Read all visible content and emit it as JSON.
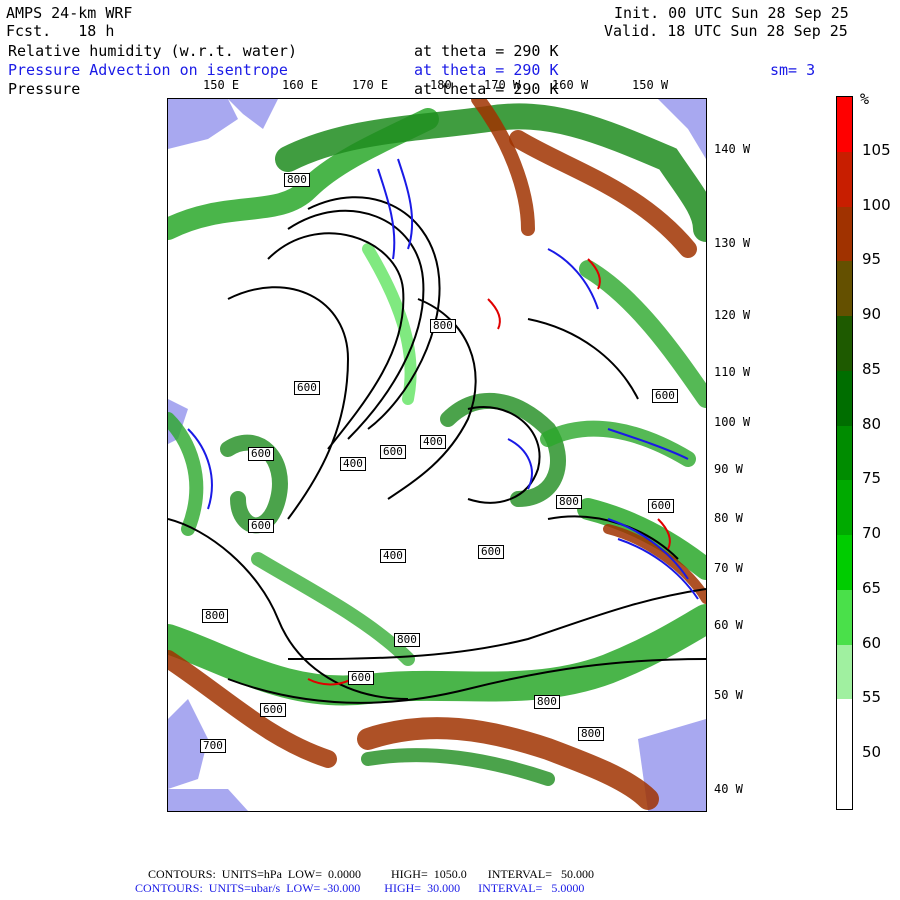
{
  "header": {
    "model": "AMPS 24-km WRF",
    "forecast": "Fcst.   18 h",
    "init": "Init. 00 UTC Sun 28 Sep 25",
    "valid": "Valid. 18 UTC Sun 28 Sep 25",
    "field1_name": "Relative humidity (w.r.t. water)",
    "field1_level": "at theta = 290 K",
    "field2_name": "Pressure Advection on isentrope",
    "field2_level": "at theta = 290 K",
    "field2_smooth": "sm= 3",
    "field3_name": "Pressure",
    "field3_level": "at theta = 290 K"
  },
  "lon_labels_top": [
    "150 E",
    "160 E",
    "170 E",
    "180",
    "170 W",
    "160 W",
    "150 W"
  ],
  "lon_labels_right": [
    "140 W",
    "130 W",
    "120 W",
    "110 W",
    "100 W",
    "90 W",
    "80 W",
    "70 W",
    "60 W",
    "50 W",
    "40 W"
  ],
  "contour_labels": [
    "800",
    "800",
    "600",
    "400",
    "400",
    "400",
    "600",
    "600",
    "600",
    "600",
    "600",
    "800",
    "800",
    "800",
    "600",
    "800",
    "600",
    "600",
    "800",
    "700"
  ],
  "colorbar": {
    "unit": "%",
    "ticks": [
      "105",
      "100",
      "95",
      "90",
      "85",
      "80",
      "75",
      "70",
      "65",
      "60",
      "55",
      "50"
    ],
    "colors": [
      "#ff0000",
      "#c81e00",
      "#a03200",
      "#645000",
      "#1e5a00",
      "#006e00",
      "#008c00",
      "#00aa00",
      "#00cc00",
      "#4ae04a",
      "#a0f0a0",
      "#ffffff",
      "#ffffff"
    ]
  },
  "footer": {
    "line1": "CONTOURS:  UNITS=hPa  LOW=  0.0000          HIGH=  1050.0       INTERVAL=   50.000",
    "line2": "CONTOURS:  UNITS=ubar/s  LOW= -30.000        HIGH=  30.000      INTERVAL=   5.0000",
    "line1_color": "#000000",
    "line2_color": "#1a1ae6"
  }
}
